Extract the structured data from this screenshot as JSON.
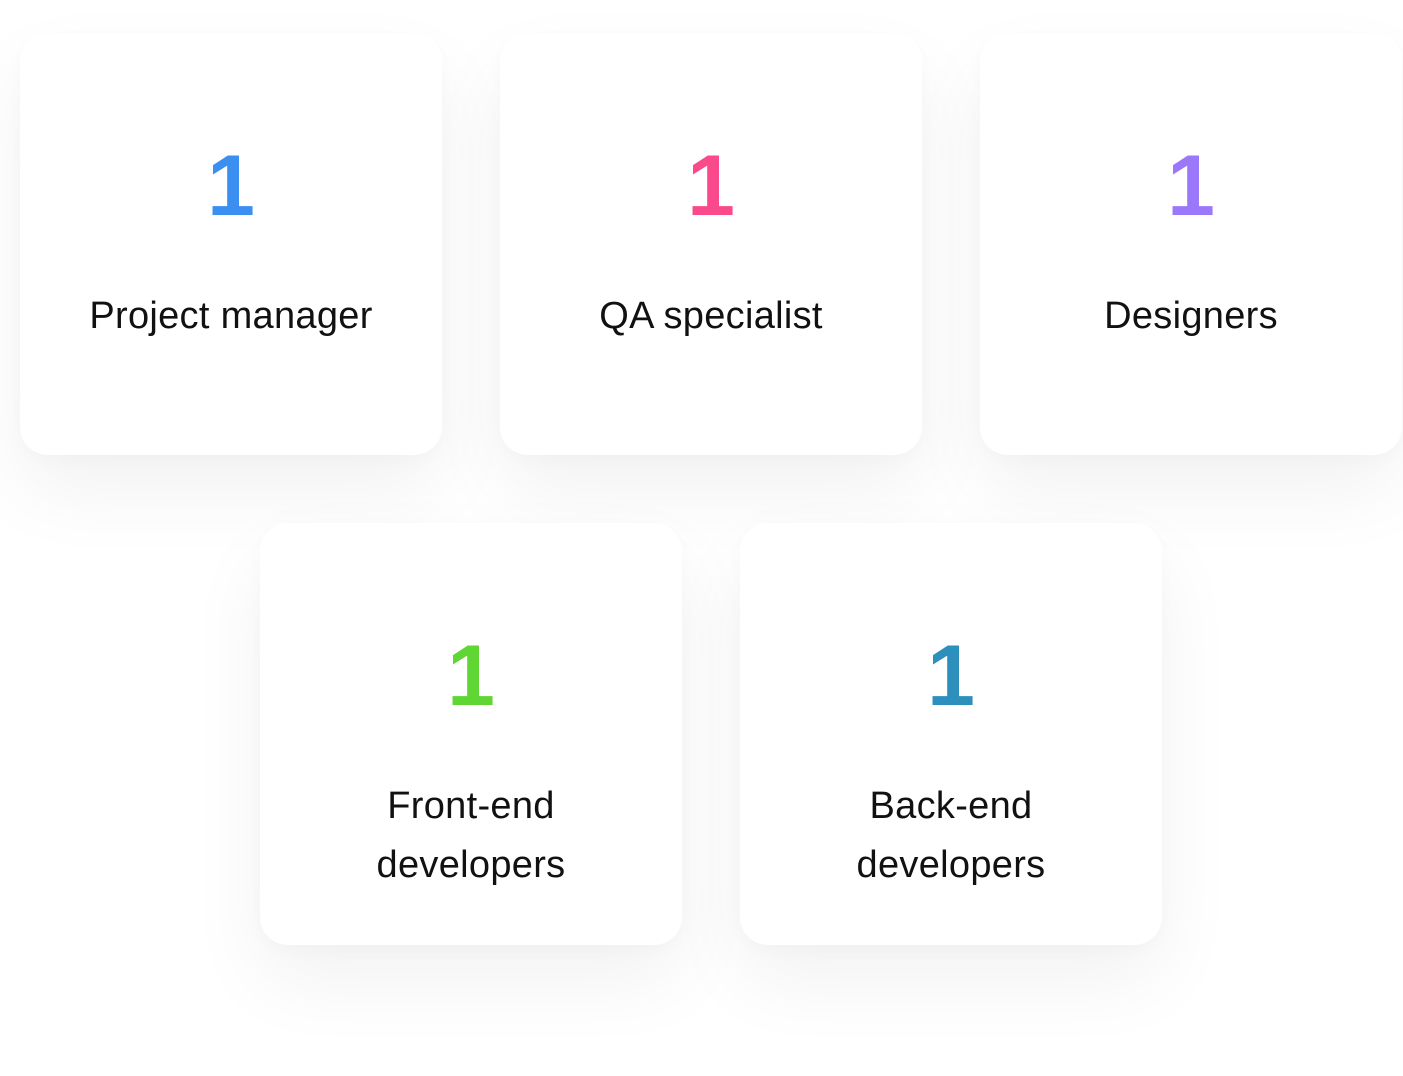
{
  "cards": [
    {
      "count": "1",
      "label_lines": [
        "Project manager"
      ],
      "color": "#3a8ff0"
    },
    {
      "count": "1",
      "label_lines": [
        "QA specialist"
      ],
      "color": "#fb4a8b"
    },
    {
      "count": "1",
      "label_lines": [
        "Designers"
      ],
      "color": "#9b78fa"
    },
    {
      "count": "1",
      "label_lines": [
        "Front-end",
        "developers"
      ],
      "color": "#5fd633"
    },
    {
      "count": "1",
      "label_lines": [
        "Back-end",
        "developers"
      ],
      "color": "#2d8fbc"
    }
  ]
}
